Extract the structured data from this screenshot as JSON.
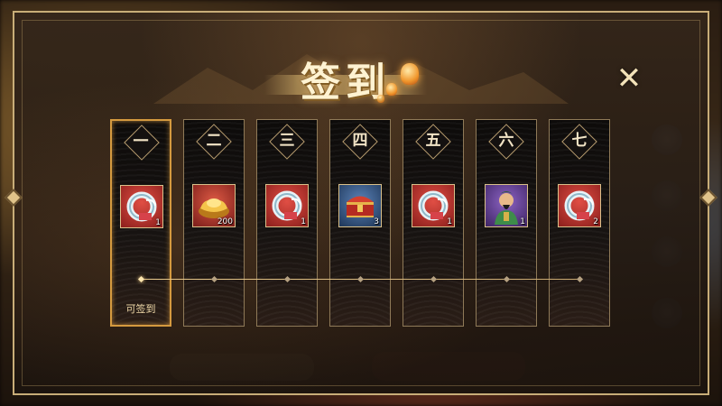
{
  "title": "签到",
  "close_icon": "close-x-icon",
  "days": [
    {
      "label": "一",
      "reward": "jade-ring",
      "qty": "1",
      "active": true,
      "status": "可签到"
    },
    {
      "label": "二",
      "reward": "gold-ingot",
      "qty": "200",
      "active": false,
      "status": ""
    },
    {
      "label": "三",
      "reward": "jade-ring",
      "qty": "1",
      "active": false,
      "status": ""
    },
    {
      "label": "四",
      "reward": "treasure-chest",
      "qty": "3",
      "active": false,
      "status": ""
    },
    {
      "label": "五",
      "reward": "jade-ring",
      "qty": "1",
      "active": false,
      "status": ""
    },
    {
      "label": "六",
      "reward": "general-portrait",
      "qty": "1",
      "active": false,
      "status": ""
    },
    {
      "label": "七",
      "reward": "jade-ring",
      "qty": "2",
      "active": false,
      "status": ""
    }
  ],
  "colors": {
    "frame": "#c8ad78",
    "active_border": "#d59a3f",
    "title": "#fff3d2"
  }
}
